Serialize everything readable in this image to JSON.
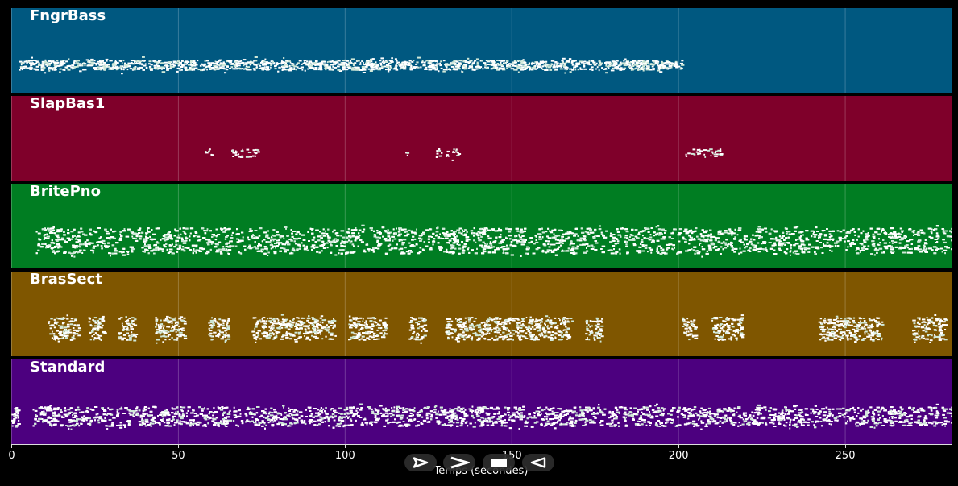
{
  "tracks": [
    {
      "name": "FngrBass",
      "color": "#005880",
      "density": 2.0,
      "spread": 6,
      "segments": [
        [
          2,
          201
        ]
      ]
    },
    {
      "name": "SlapBas1",
      "color": "#7f002a",
      "density": 0.8,
      "spread": 5,
      "segments": [
        [
          58,
          60
        ],
        [
          65,
          74
        ],
        [
          118,
          119
        ],
        [
          127,
          134
        ],
        [
          202,
          213
        ]
      ]
    },
    {
      "name": "BritePno",
      "color": "#007d22",
      "density": 4.5,
      "spread": 16,
      "segments": [
        [
          7,
          282
        ]
      ]
    },
    {
      "name": "BrasSect",
      "color": "#7f5600",
      "density": 3.0,
      "spread": 14,
      "segments": [
        [
          11,
          20
        ],
        [
          23,
          28
        ],
        [
          32,
          37
        ],
        [
          43,
          52
        ],
        [
          59,
          65
        ],
        [
          72,
          97
        ],
        [
          101,
          112
        ],
        [
          119,
          124
        ],
        [
          130,
          168
        ],
        [
          172,
          177
        ],
        [
          201,
          205
        ],
        [
          210,
          219
        ],
        [
          242,
          261
        ],
        [
          270,
          280
        ]
      ]
    },
    {
      "name": "Standard",
      "color": "#4c007f",
      "density": 4.0,
      "spread": 12,
      "segments": [
        [
          0,
          2
        ],
        [
          6,
          282
        ]
      ]
    }
  ],
  "x_axis": {
    "label": "Temps (secondes)",
    "min": 0,
    "max": 282,
    "ticks": [
      0,
      50,
      100,
      150,
      200,
      250
    ]
  },
  "controls": [
    {
      "name": "play-button",
      "icon": "play-icon"
    },
    {
      "name": "fast-forward-button",
      "icon": "fast-forward-icon"
    },
    {
      "name": "stop-button",
      "icon": "stop-icon"
    },
    {
      "name": "rewind-button",
      "icon": "rewind-icon"
    }
  ]
}
